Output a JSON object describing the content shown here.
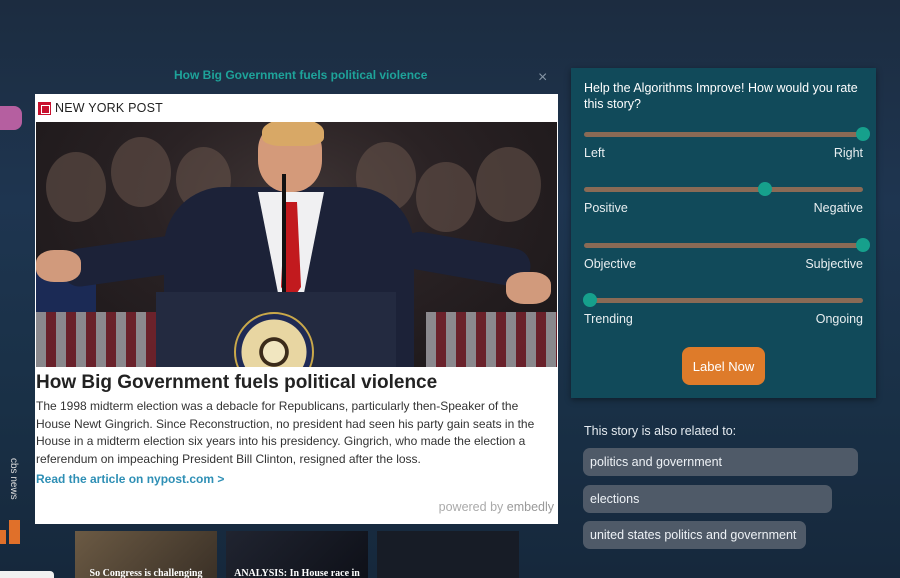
{
  "popup": {
    "title": "How Big Government fuels political violence",
    "close_label": "×"
  },
  "card": {
    "publisher": "NEW YORK POST",
    "headline": "How Big Government fuels political violence",
    "summary": "The 1998 midterm election was a debacle for Republicans, particularly then-Speaker of the House Newt Gingrich. Since Reconstruction, no president had seen his party gain seats in the House in a midterm election six years into his presidency. Gingrich, who made the election a referendum on impeaching President Bill Clinton, resigned after the loss.",
    "read_link": "Read the article on nypost.com >",
    "powered_prefix": "powered by",
    "powered_brand": "embedly"
  },
  "rating_panel": {
    "question": "Help the Algorithms Improve! How would you rate this story?",
    "sliders": [
      {
        "left": "Left",
        "right": "Right",
        "value": 1.0
      },
      {
        "left": "Positive",
        "right": "Negative",
        "value": 0.65
      },
      {
        "left": "Objective",
        "right": "Subjective",
        "value": 1.0
      },
      {
        "left": "Trending",
        "right": "Ongoing",
        "value": 0.02
      }
    ],
    "button_label": "Label Now"
  },
  "related": {
    "title": "This story is also related to:",
    "topics": [
      "politics and government",
      "elections",
      "united states politics and government"
    ]
  },
  "side": {
    "vertical_text": "cbs news"
  },
  "thumbnails": [
    {
      "caption": "So Congress is challenging"
    },
    {
      "caption": "ANALYSIS: In House race in"
    },
    {
      "caption": ""
    }
  ],
  "colors": {
    "accent_teal": "#1ea39a",
    "panel_bg": "#114a5a",
    "button_orange": "#de7b2a",
    "chip_bg": "#4f5a68"
  }
}
